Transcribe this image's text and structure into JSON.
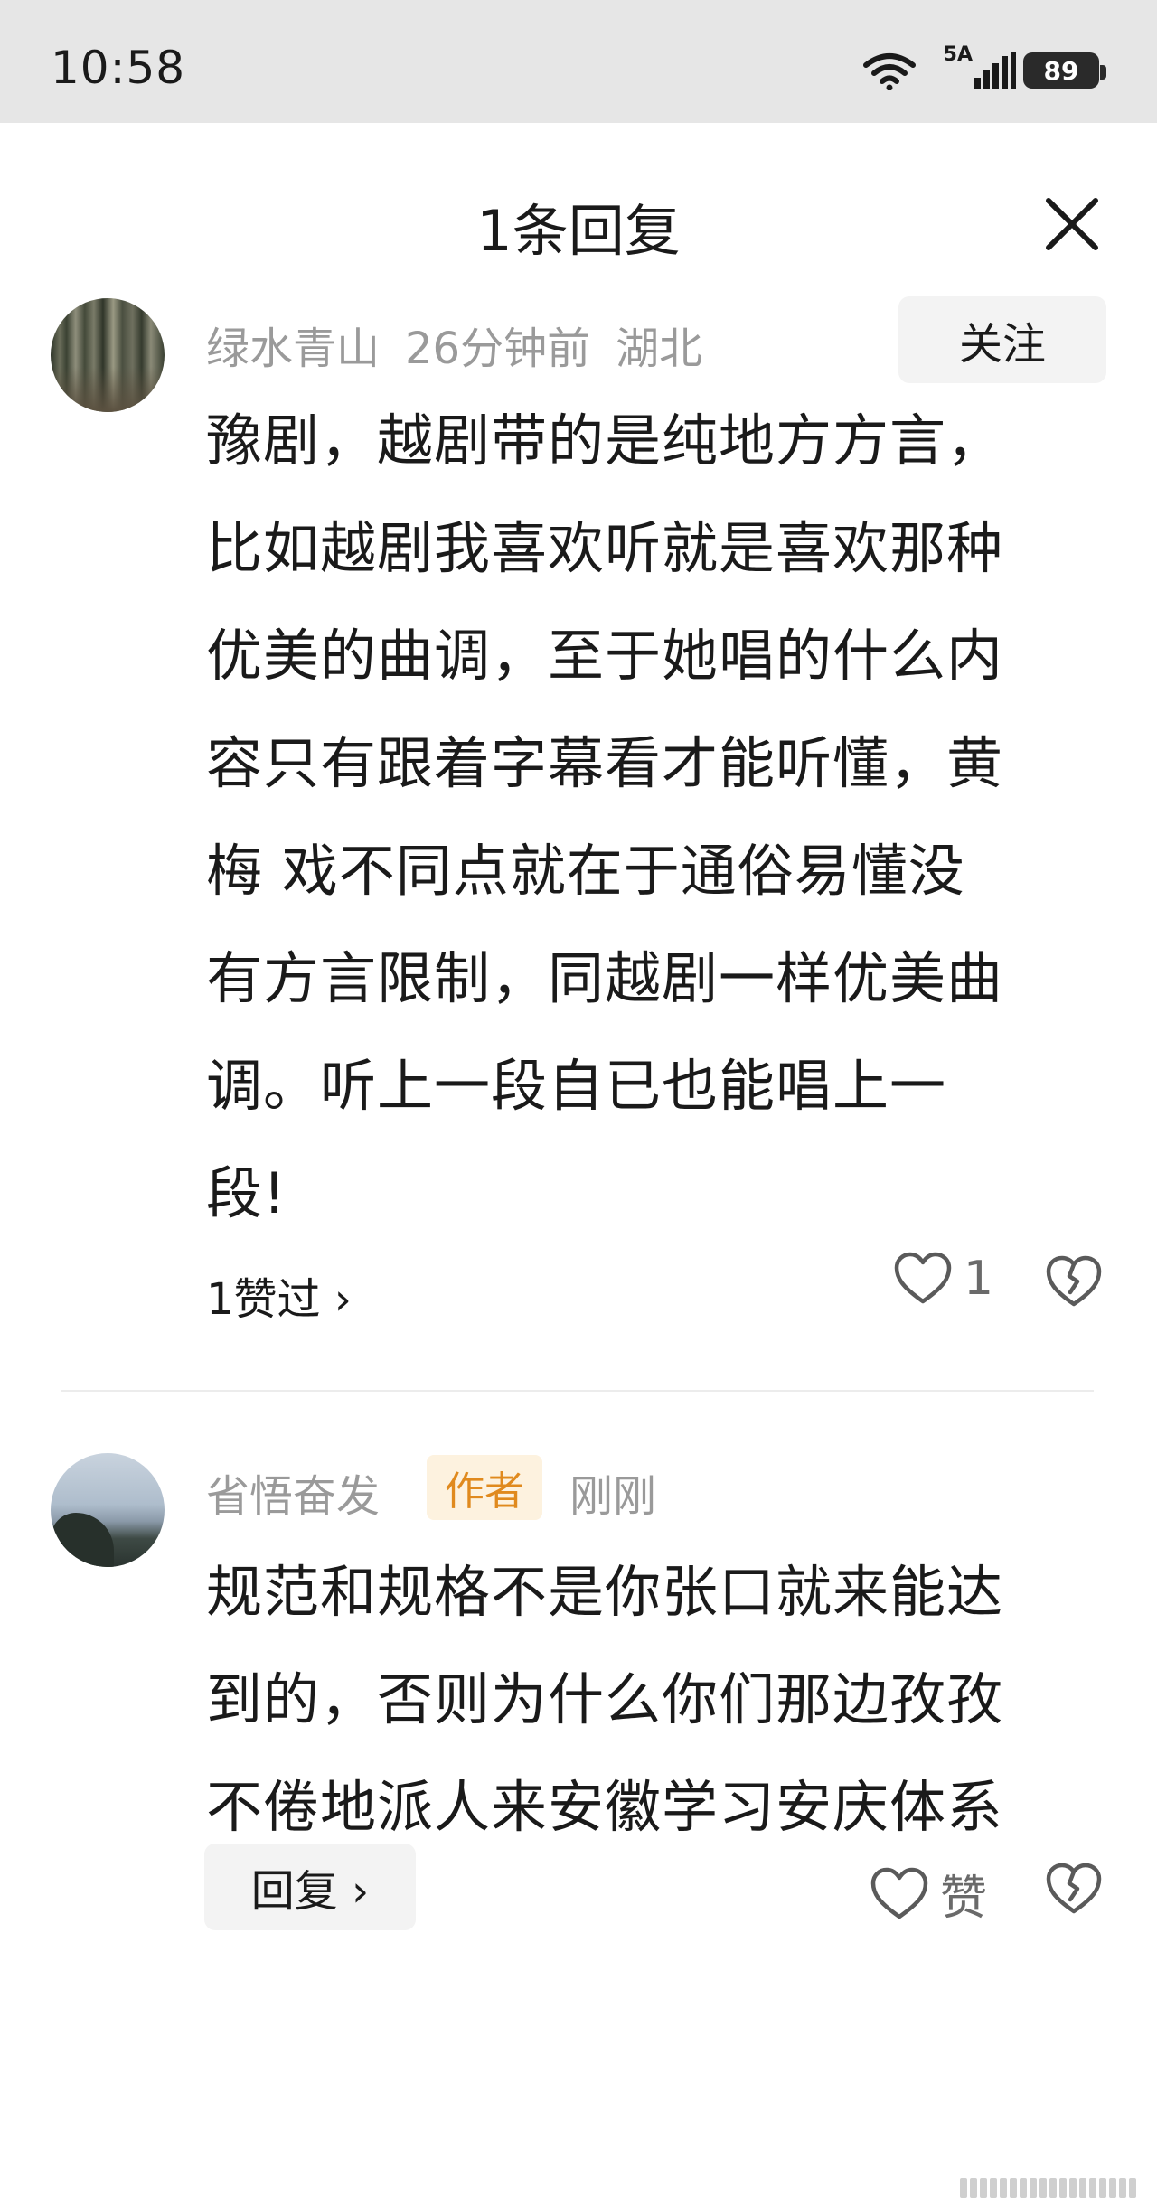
{
  "status_bar": {
    "time": "10:58",
    "network_label": "5A",
    "battery": "89",
    "icons": [
      "wifi-icon",
      "signal-icon",
      "battery-icon"
    ]
  },
  "sheet": {
    "title": "1条回复",
    "close_icon": "close-icon"
  },
  "comment": {
    "author": "绿水青山",
    "time": "26分钟前",
    "location": "湖北",
    "follow_label": "关注",
    "lines": [
      "豫剧，越剧带的是纯地方方言，",
      "比如越剧我喜欢听就是喜欢那种",
      "优美的曲调，至于她唱的什么内",
      "容只有跟着字幕看才能听懂，黄",
      "梅 戏不同点就在于通俗易懂没",
      "有方言限制，同越剧一样优美曲",
      "调。听上一段自已也能唱上一",
      "段!"
    ],
    "likes_link": "1赞过 ›",
    "like_count": "1"
  },
  "reply": {
    "author": "省悟奋发",
    "badge": "作者",
    "time": "刚刚",
    "lines": [
      "规范和规格不是你张口就来能达",
      "到的，否则为什么你们那边孜孜",
      "不倦地派人来安徽学习安庆体系"
    ],
    "reply_label": "回复 ›",
    "like_label": "赞"
  },
  "colors": {
    "status_bg": "#e6e6e6",
    "meta_text": "#9a9a9a",
    "badge_text": "#e08a1e",
    "badge_bg": "#fdf2df",
    "button_bg": "#f3f3f3"
  }
}
